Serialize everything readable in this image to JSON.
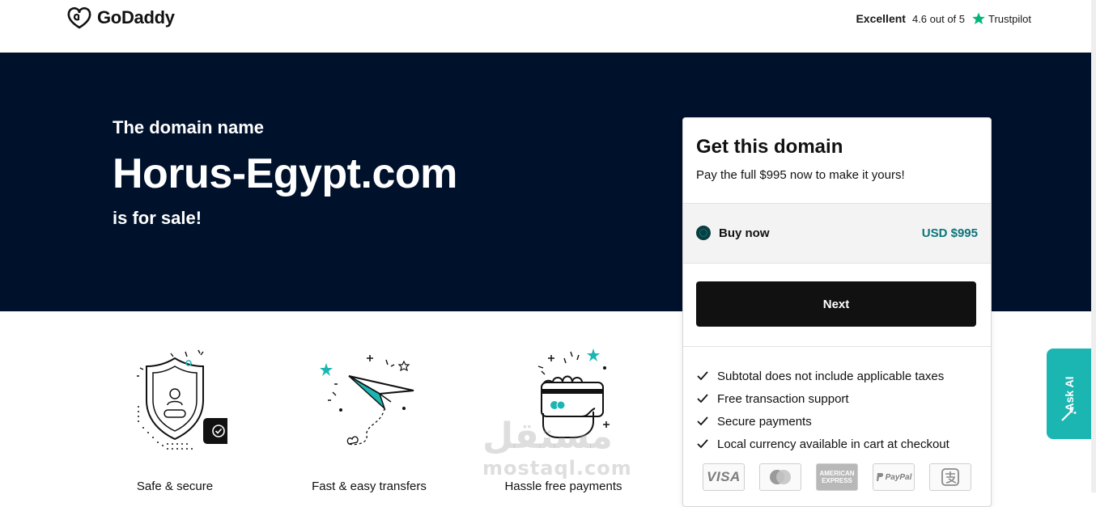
{
  "header": {
    "logo_text": "GoDaddy",
    "trustpilot": {
      "rating_word": "Excellent",
      "rating_text": "4.6 out of 5",
      "brand": "Trustpilot",
      "star_color": "#00b67a"
    }
  },
  "hero": {
    "intro": "The domain name",
    "domain": "Horus-Egypt.com",
    "suffix": "is for sale!",
    "background_color": "#00112c"
  },
  "features": [
    {
      "label": "Safe & secure",
      "icon": "shield-check-icon"
    },
    {
      "label": "Fast & easy transfers",
      "icon": "paper-plane-icon"
    },
    {
      "label": "Hassle free payments",
      "icon": "hand-card-icon"
    }
  ],
  "card": {
    "title": "Get this domain",
    "subtitle": "Pay the full $995 now to make it yours!",
    "option": {
      "label": "Buy now",
      "price": "USD $995",
      "selected": true
    },
    "next_label": "Next",
    "bullets": [
      "Subtotal does not include applicable taxes",
      "Free transaction support",
      "Secure payments",
      "Local currency available in cart at checkout"
    ],
    "payment_methods": {
      "visa": "VISA",
      "amex_line1": "AMERICAN",
      "amex_line2": "EXPRESS",
      "paypal": "PayPal"
    },
    "accent_color": "#09757a"
  },
  "ask_ai": {
    "label": "Ask AI",
    "color": "#1bb6b2"
  },
  "watermark": {
    "arabic": "مستقل",
    "latin": "mostaql.com"
  }
}
